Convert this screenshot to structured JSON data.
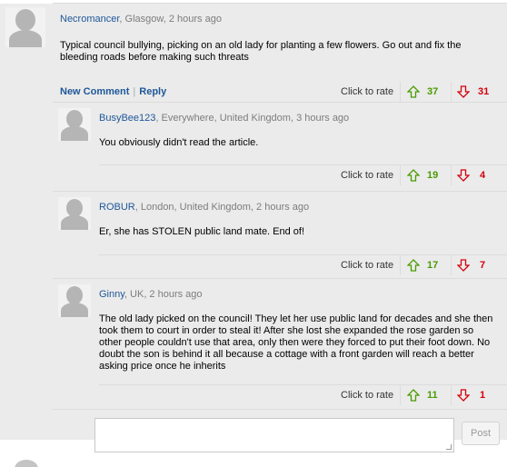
{
  "main_comment": {
    "username": "Necromancer",
    "meta_rest": ", Glasgow, 2 hours ago",
    "text": "Typical council bullying, picking on an old lady for planting a few flowers. Go out and fix the bleeding roads before making such threats",
    "new_comment_label": "New Comment",
    "reply_label": "Reply",
    "rate_label": "Click to rate",
    "up": "37",
    "down": "31"
  },
  "replies": [
    {
      "username": "BusyBee123",
      "meta_rest": ", Everywhere, United Kingdom, 3 hours ago",
      "text": "You obviously didn't read the article.",
      "rate_label": "Click to rate",
      "up": "19",
      "down": "4"
    },
    {
      "username": "ROBUR",
      "meta_rest": ", London, United Kingdom, 2 hours ago",
      "text": "Er, she has STOLEN public land mate. End of!",
      "rate_label": "Click to rate",
      "up": "17",
      "down": "7"
    },
    {
      "username": "Ginny",
      "meta_rest": ", UK, 2 hours ago",
      "text": "The old lady picked on the council! They let her use public land for decades and she then took them to court in order to steal it! After she lost she expanded the rose garden so other people couldn't use that area, only then were they forced to put their foot down. No doubt the son is behind it all because a cottage with a front garden will reach a better asking price once he inherits",
      "rate_label": "Click to rate",
      "up": "11",
      "down": "1"
    }
  ],
  "reply_box": {
    "post_label": "Post"
  },
  "colors": {
    "background": "#ebebeb",
    "link": "#1e5799",
    "up": "#4a9b00",
    "down": "#d3000c"
  },
  "icons": [
    "avatar-placeholder-icon",
    "thumb-up-arrow-icon",
    "thumb-down-arrow-icon"
  ]
}
